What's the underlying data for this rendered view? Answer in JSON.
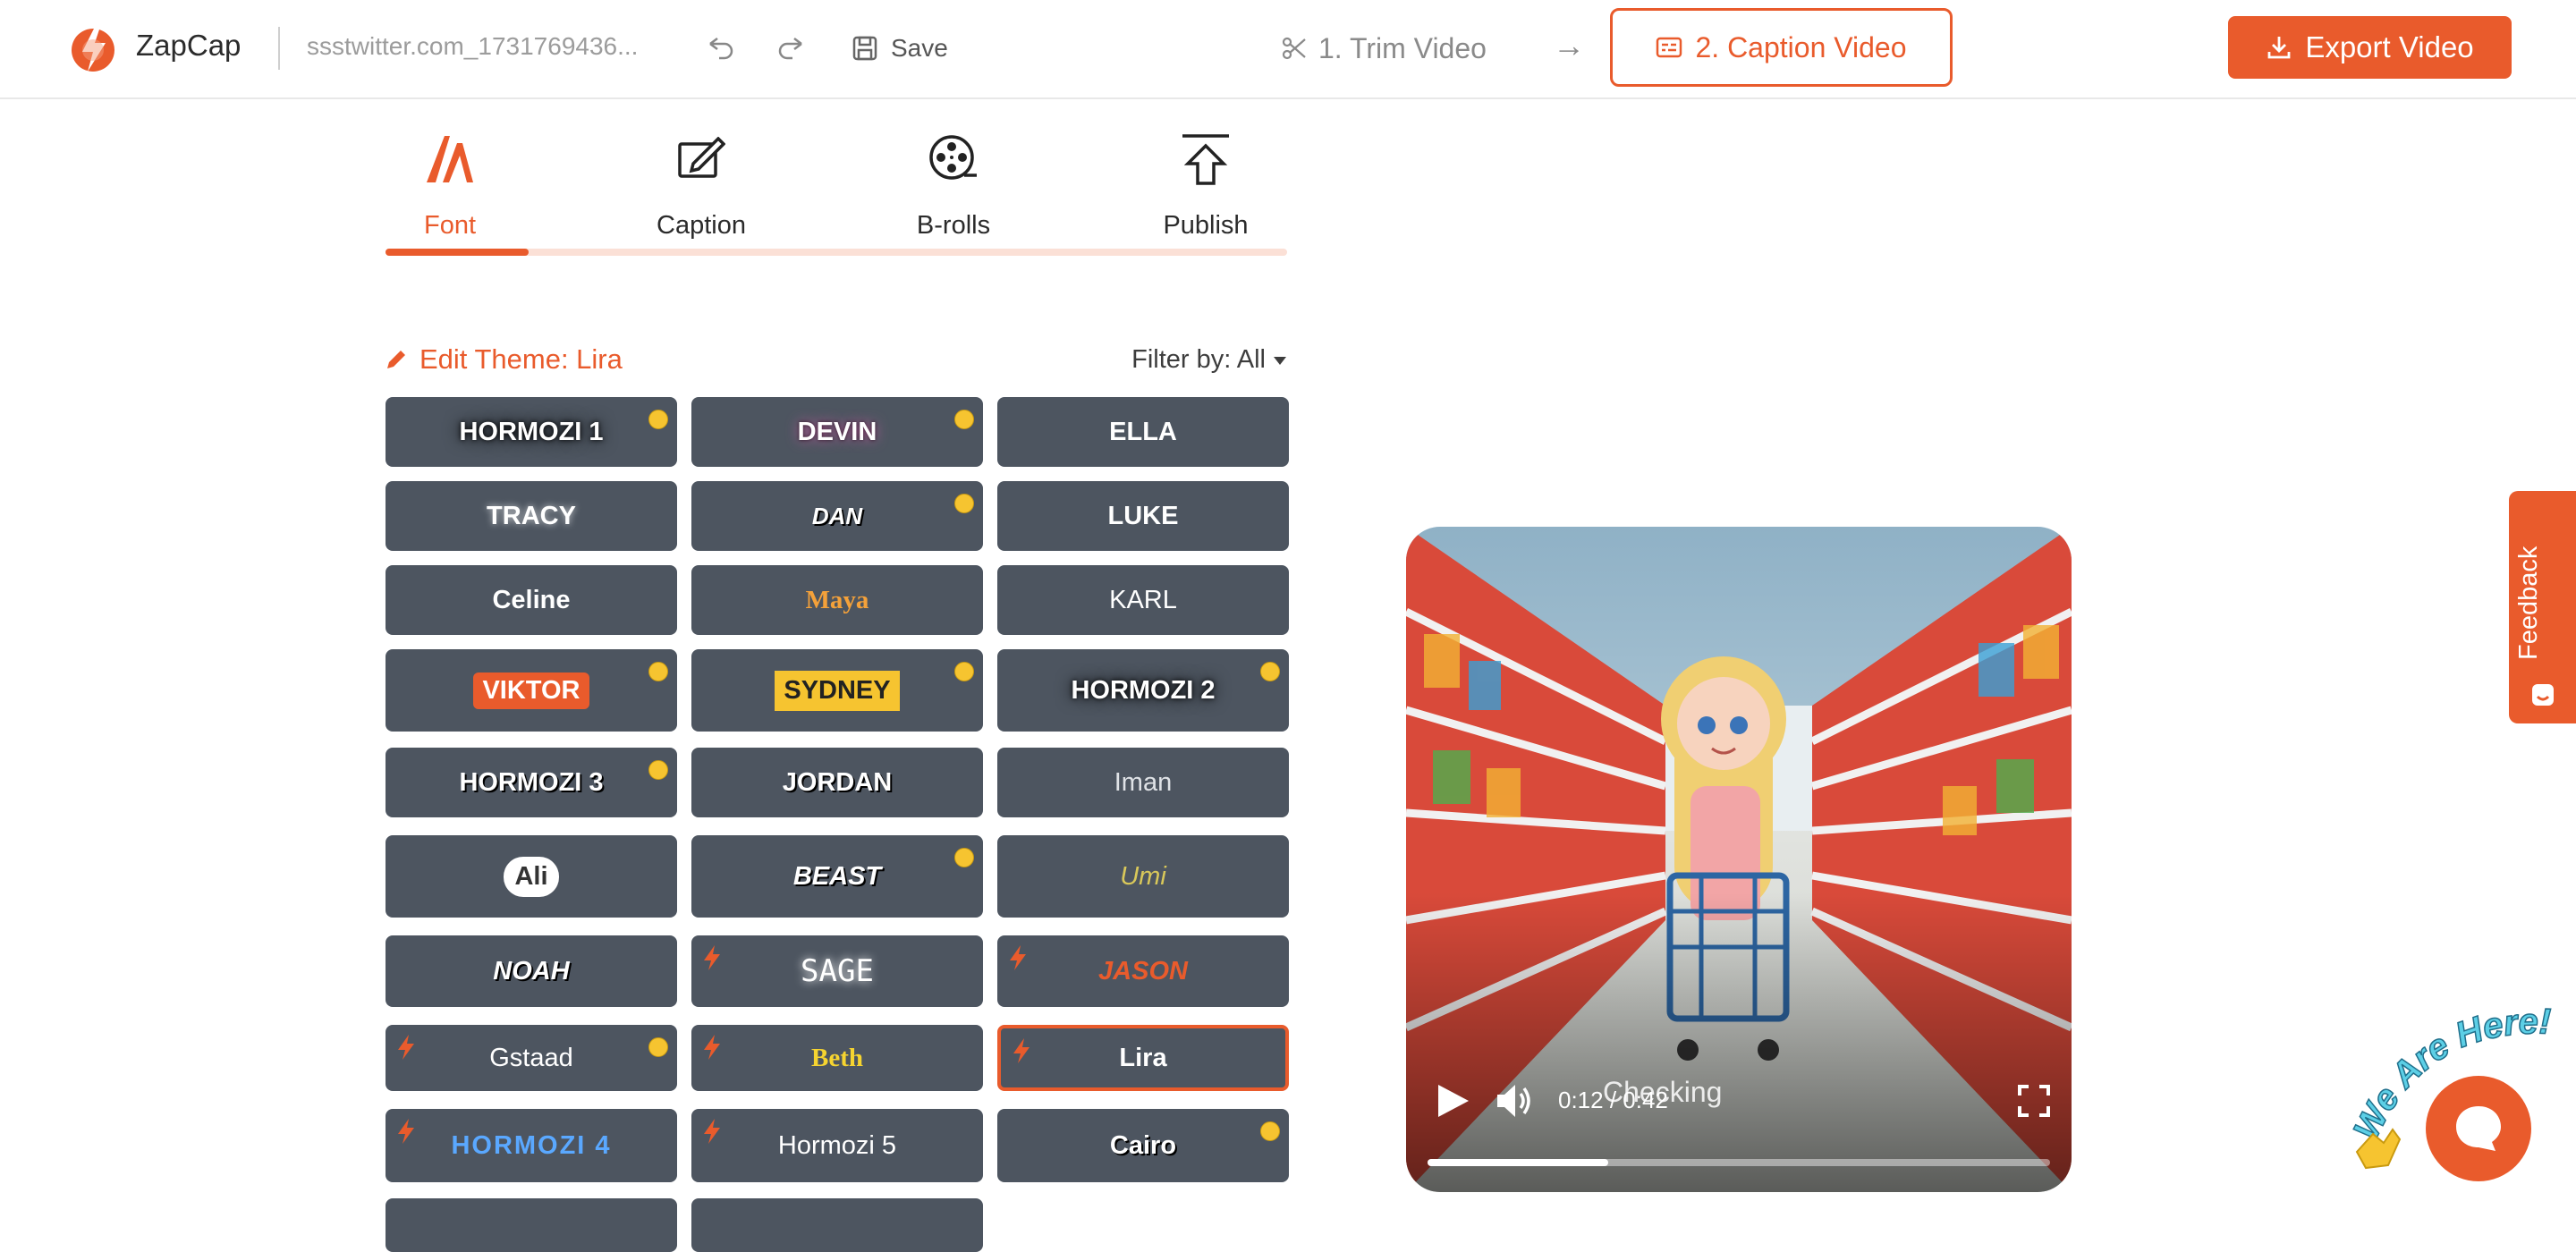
{
  "app": {
    "name": "ZapCap",
    "filename": "ssstwitter.com_1731769436..."
  },
  "toolbar": {
    "save_label": "Save",
    "undo_icon": "undo-icon",
    "redo_icon": "redo-icon"
  },
  "steps": {
    "step1": "1. Trim Video",
    "step2": "2. Caption Video"
  },
  "export": {
    "label": "Export Video"
  },
  "colors": {
    "accent": "#e95b2c",
    "card_bg": "#4d5560",
    "tab_track": "#fbe0d6"
  },
  "tabs": [
    {
      "label": "Font",
      "icon": "font-icon",
      "active": true
    },
    {
      "label": "Caption",
      "icon": "edit-icon",
      "active": false
    },
    {
      "label": "B-rolls",
      "icon": "film-reel-icon",
      "active": false
    },
    {
      "label": "Publish",
      "icon": "upload-icon",
      "active": false
    }
  ],
  "theme": {
    "edit_label": "Edit Theme: Lira",
    "filter_label": "Filter by: All"
  },
  "fonts": [
    {
      "name": "HORMOZI 1",
      "emoji": true,
      "bolt": false
    },
    {
      "name": "DEVIN",
      "emoji": true,
      "bolt": false
    },
    {
      "name": "ELLA",
      "emoji": false,
      "bolt": false
    },
    {
      "name": "TRACY",
      "emoji": false,
      "bolt": false
    },
    {
      "name": "DAN",
      "emoji": true,
      "bolt": false
    },
    {
      "name": "LUKE",
      "emoji": false,
      "bolt": false
    },
    {
      "name": "Celine",
      "emoji": false,
      "bolt": false
    },
    {
      "name": "Maya",
      "emoji": false,
      "bolt": false
    },
    {
      "name": "KARL",
      "emoji": false,
      "bolt": false
    },
    {
      "name": "VIKTOR",
      "emoji": true,
      "bolt": false
    },
    {
      "name": "SYDNEY",
      "emoji": true,
      "bolt": false
    },
    {
      "name": "HORMOZI 2",
      "emoji": true,
      "bolt": false
    },
    {
      "name": "HORMOZI 3",
      "emoji": true,
      "bolt": false
    },
    {
      "name": "JORDAN",
      "emoji": false,
      "bolt": false
    },
    {
      "name": "Iman",
      "emoji": false,
      "bolt": false
    },
    {
      "name": "Ali",
      "emoji": false,
      "bolt": false
    },
    {
      "name": "BEAST",
      "emoji": true,
      "bolt": false
    },
    {
      "name": "Umi",
      "emoji": false,
      "bolt": false
    },
    {
      "name": "NOAH",
      "emoji": false,
      "bolt": false
    },
    {
      "name": "SAGE",
      "emoji": false,
      "bolt": true
    },
    {
      "name": "JASON",
      "emoji": false,
      "bolt": true
    },
    {
      "name": "Gstaad",
      "emoji": true,
      "bolt": true
    },
    {
      "name": "Beth",
      "emoji": false,
      "bolt": true
    },
    {
      "name": "Lira",
      "emoji": false,
      "bolt": true,
      "selected": true
    },
    {
      "name": "HORMOZI 4",
      "emoji": false,
      "bolt": true
    },
    {
      "name": "Hormozi 5",
      "emoji": false,
      "bolt": true
    },
    {
      "name": "Cairo",
      "emoji": true,
      "bolt": false
    }
  ],
  "player": {
    "time": "0:12 / 0:42",
    "caption": "Checking",
    "progress": 0.29
  },
  "feedback": {
    "label": "Feedback"
  },
  "chat": {
    "badge_text": "We Are Here!"
  }
}
